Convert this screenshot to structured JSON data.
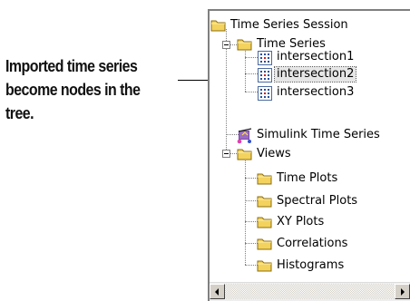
{
  "annotation": {
    "lines": [
      "Imported time series",
      "become nodes in the",
      "tree."
    ]
  },
  "tree": {
    "root": {
      "label": "Time Series Session",
      "icon": "folder-icon"
    },
    "time_series": {
      "label": "Time Series",
      "icon": "folder-icon",
      "items": [
        {
          "label": "intersection1",
          "icon": "timeseries-data-icon"
        },
        {
          "label": "intersection2",
          "icon": "timeseries-data-icon",
          "selected": true
        },
        {
          "label": "intersection3",
          "icon": "timeseries-data-icon"
        }
      ]
    },
    "simulink": {
      "label": "Simulink Time Series",
      "icon": "simulink-icon"
    },
    "views": {
      "label": "Views",
      "icon": "folder-icon",
      "items": [
        {
          "label": "Time Plots",
          "icon": "folder-icon"
        },
        {
          "label": "Spectral Plots",
          "icon": "folder-icon"
        },
        {
          "label": "XY Plots",
          "icon": "folder-icon"
        },
        {
          "label": "Correlations",
          "icon": "folder-icon"
        },
        {
          "label": "Histograms",
          "icon": "folder-icon"
        }
      ]
    }
  },
  "colors": {
    "folder": "#f3d25e",
    "folder_border": "#8c6d10",
    "selection": "#e6e6e6"
  }
}
